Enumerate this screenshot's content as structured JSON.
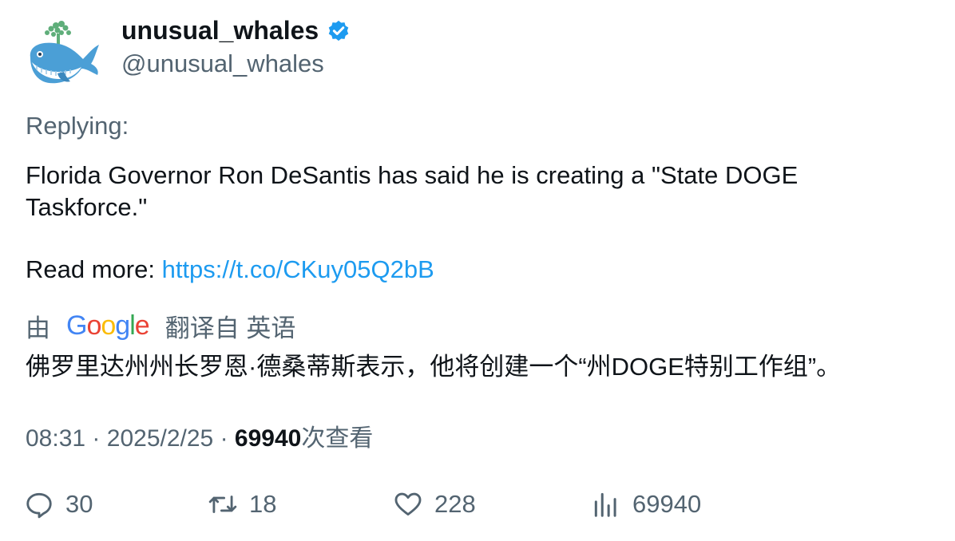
{
  "author": {
    "display_name": "unusual_whales",
    "handle": "@unusual_whales",
    "verified_badge_icon": "verified-check-icon",
    "avatar_icon": "whale-avatar-icon"
  },
  "tweet": {
    "replying_label": "Replying:",
    "text": "Florida Governor Ron DeSantis has said he is creating a \"State DOGE Taskforce.\"",
    "read_more_label": "Read more: ",
    "link": "https://t.co/CKuy05Q2bB"
  },
  "translation": {
    "prefix": "由",
    "provider": "Google",
    "suffix": "翻译自 英语",
    "text": "佛罗里达州州长罗恩·德桑蒂斯表示，他将创建一个“州DOGE特别工作组”。"
  },
  "meta": {
    "time": "08:31",
    "separator": "·",
    "date": "2025/2/25",
    "views_count": "69940",
    "views_label": "次查看"
  },
  "actions": {
    "replies": "30",
    "retweets": "18",
    "likes": "228",
    "views": "69940"
  },
  "colors": {
    "link": "#1d9bf0",
    "secondary_text": "#536471",
    "primary_text": "#0f1419",
    "verified": "#1d9bf0"
  }
}
